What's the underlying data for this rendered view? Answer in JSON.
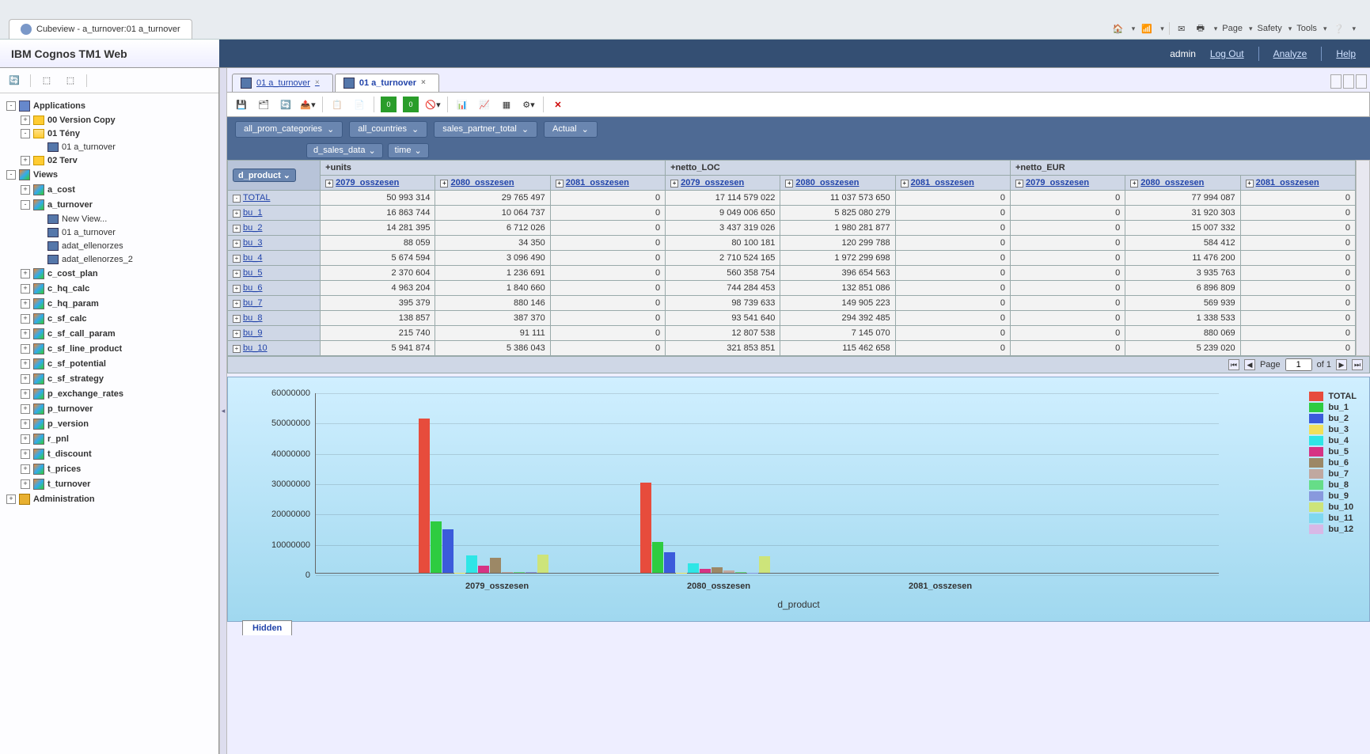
{
  "browser": {
    "tab_title": "Cubeview - a_turnover:01 a_turnover",
    "tools": {
      "page": "Page",
      "safety": "Safety",
      "tools": "Tools"
    }
  },
  "app": {
    "title": "IBM Cognos TM1 Web",
    "user": "admin",
    "logout": "Log Out",
    "analyze": "Analyze",
    "help": "Help"
  },
  "tree": {
    "applications": "Applications",
    "version_copy": "00 Version Copy",
    "teny": "01 Tény",
    "teny_01": "01 a_turnover",
    "terv": "02 Terv",
    "views": "Views",
    "a_cost": "a_cost",
    "a_turnover": "a_turnover",
    "new_view": "New View...",
    "v_01": "01 a_turnover",
    "v_adat1": "adat_ellenorzes",
    "v_adat2": "adat_ellenorzes_2",
    "c_cost_plan": "c_cost_plan",
    "c_hq_calc": "c_hq_calc",
    "c_hq_param": "c_hq_param",
    "c_sf_calc": "c_sf_calc",
    "c_sf_call_param": "c_sf_call_param",
    "c_sf_line_product": "c_sf_line_product",
    "c_sf_potential": "c_sf_potential",
    "c_sf_strategy": "c_sf_strategy",
    "p_exchange_rates": "p_exchange_rates",
    "p_turnover": "p_turnover",
    "p_version": "p_version",
    "r_pnl": "r_pnl",
    "t_discount": "t_discount",
    "t_prices": "t_prices",
    "t_turnover": "t_turnover",
    "administration": "Administration"
  },
  "doc_tabs": {
    "t1": "01 a_turnover",
    "t2": "01 a_turnover"
  },
  "context": {
    "c1": "all_prom_categories",
    "c2": "all_countries",
    "c3": "sales_partner_total",
    "c4": "Actual"
  },
  "dims": {
    "col1": "d_sales_data",
    "col2": "time",
    "row": "d_product"
  },
  "groups": {
    "g1": "units",
    "g2": "netto_LOC",
    "g3": "netto_EUR"
  },
  "cols": {
    "c1": "2079_osszesen",
    "c2": "2080_osszesen",
    "c3": "2081_osszesen"
  },
  "rows": [
    {
      "label": "TOTAL",
      "u1": "50 993 314",
      "u2": "29 765 497",
      "u3": "0",
      "l1": "17 114 579 022",
      "l2": "11 037 573 650",
      "l3": "0",
      "e1": "0",
      "e2": "77 994 087",
      "e3": "0",
      "total": true
    },
    {
      "label": "bu_1",
      "u1": "16 863 744",
      "u2": "10 064 737",
      "u3": "0",
      "l1": "9 049 006 650",
      "l2": "5 825 080 279",
      "l3": "0",
      "e1": "0",
      "e2": "31 920 303",
      "e3": "0"
    },
    {
      "label": "bu_2",
      "u1": "14 281 395",
      "u2": "6 712 026",
      "u3": "0",
      "l1": "3 437 319 026",
      "l2": "1 980 281 877",
      "l3": "0",
      "e1": "0",
      "e2": "15 007 332",
      "e3": "0"
    },
    {
      "label": "bu_3",
      "u1": "88 059",
      "u2": "34 350",
      "u3": "0",
      "l1": "80 100 181",
      "l2": "120 299 788",
      "l3": "0",
      "e1": "0",
      "e2": "584 412",
      "e3": "0"
    },
    {
      "label": "bu_4",
      "u1": "5 674 594",
      "u2": "3 096 490",
      "u3": "0",
      "l1": "2 710 524 165",
      "l2": "1 972 299 698",
      "l3": "0",
      "e1": "0",
      "e2": "11 476 200",
      "e3": "0"
    },
    {
      "label": "bu_5",
      "u1": "2 370 604",
      "u2": "1 236 691",
      "u3": "0",
      "l1": "560 358 754",
      "l2": "396 654 563",
      "l3": "0",
      "e1": "0",
      "e2": "3 935 763",
      "e3": "0"
    },
    {
      "label": "bu_6",
      "u1": "4 963 204",
      "u2": "1 840 660",
      "u3": "0",
      "l1": "744 284 453",
      "l2": "132 851 086",
      "l3": "0",
      "e1": "0",
      "e2": "6 896 809",
      "e3": "0"
    },
    {
      "label": "bu_7",
      "u1": "395 379",
      "u2": "880 146",
      "u3": "0",
      "l1": "98 739 633",
      "l2": "149 905 223",
      "l3": "0",
      "e1": "0",
      "e2": "569 939",
      "e3": "0"
    },
    {
      "label": "bu_8",
      "u1": "138 857",
      "u2": "387 370",
      "u3": "0",
      "l1": "93 541 640",
      "l2": "294 392 485",
      "l3": "0",
      "e1": "0",
      "e2": "1 338 533",
      "e3": "0"
    },
    {
      "label": "bu_9",
      "u1": "215 740",
      "u2": "91 111",
      "u3": "0",
      "l1": "12 807 538",
      "l2": "7 145 070",
      "l3": "0",
      "e1": "0",
      "e2": "880 069",
      "e3": "0"
    },
    {
      "label": "bu_10",
      "u1": "5 941 874",
      "u2": "5 386 043",
      "u3": "0",
      "l1": "321 853 851",
      "l2": "115 462 658",
      "l3": "0",
      "e1": "0",
      "e2": "5 239 020",
      "e3": "0"
    }
  ],
  "pager": {
    "page_lbl": "Page",
    "page": "1",
    "of": "of 1"
  },
  "hidden_tab": "Hidden",
  "chart_data": {
    "type": "bar",
    "categories": [
      "2079_osszesen",
      "2080_osszesen",
      "2081_osszesen"
    ],
    "xlabel": "d_product",
    "ylim": [
      0,
      60000000
    ],
    "yticks": [
      0,
      10000000,
      20000000,
      30000000,
      40000000,
      50000000,
      60000000
    ],
    "series": [
      {
        "name": "TOTAL",
        "color": "#e74c3c",
        "values": [
          50993314,
          29765497,
          0
        ]
      },
      {
        "name": "bu_1",
        "color": "#2ecc40",
        "values": [
          16863744,
          10064737,
          0
        ]
      },
      {
        "name": "bu_2",
        "color": "#3b5bdb",
        "values": [
          14281395,
          6712026,
          0
        ]
      },
      {
        "name": "bu_3",
        "color": "#f1e05a",
        "values": [
          88059,
          34350,
          0
        ]
      },
      {
        "name": "bu_4",
        "color": "#2ee6e6",
        "values": [
          5674594,
          3096490,
          0
        ]
      },
      {
        "name": "bu_5",
        "color": "#d63384",
        "values": [
          2370604,
          1236691,
          0
        ]
      },
      {
        "name": "bu_6",
        "color": "#9c8866",
        "values": [
          4963204,
          1840660,
          0
        ]
      },
      {
        "name": "bu_7",
        "color": "#c0a8a0",
        "values": [
          395379,
          880146,
          0
        ]
      },
      {
        "name": "bu_8",
        "color": "#66dd88",
        "values": [
          138857,
          387370,
          0
        ]
      },
      {
        "name": "bu_9",
        "color": "#8899dd",
        "values": [
          215740,
          91111,
          0
        ]
      },
      {
        "name": "bu_10",
        "color": "#cde47a",
        "values": [
          5941874,
          5386043,
          0
        ]
      },
      {
        "name": "bu_11",
        "color": "#7fd8f0",
        "values": [
          0,
          0,
          0
        ]
      },
      {
        "name": "bu_12",
        "color": "#d8b8e6",
        "values": [
          0,
          0,
          0
        ]
      }
    ]
  }
}
